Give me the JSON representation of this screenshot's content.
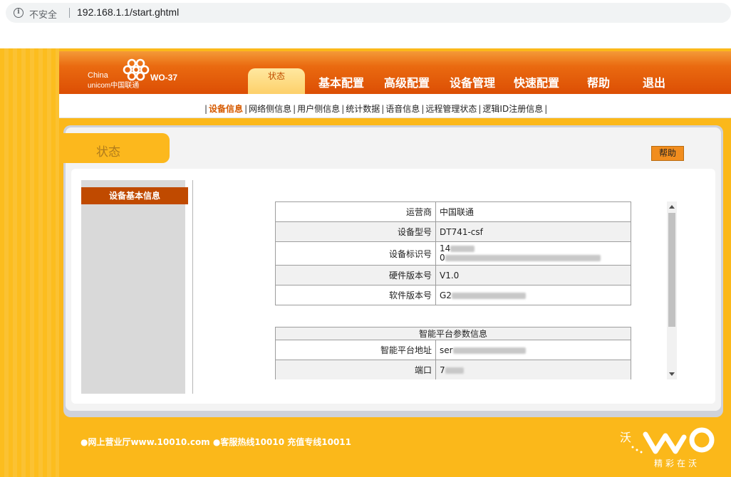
{
  "browser": {
    "security_label": "不安全",
    "url": "192.168.1.1/start.ghtml"
  },
  "header": {
    "logo_text_1": "China",
    "logo_text_2": "unicom中国联通",
    "model": "WO-37"
  },
  "nav": {
    "items": [
      "状态",
      "基本配置",
      "高级配置",
      "设备管理",
      "快速配置",
      "帮助",
      "退出"
    ],
    "active_index": 0
  },
  "subnav": {
    "items": [
      "设备信息",
      "网络侧信息",
      "用户侧信息",
      "统计数据",
      "语音信息",
      "远程管理状态",
      "逻辑ID注册信息"
    ],
    "active_index": 0
  },
  "panel": {
    "title": "状态",
    "help_label": "帮助"
  },
  "leftnav": {
    "items": [
      "设备基本信息"
    ]
  },
  "device_info": [
    {
      "label": "运营商",
      "value": "中国联通"
    },
    {
      "label": "设备型号",
      "value": "DT741-csf"
    },
    {
      "label": "设备标识号",
      "value_1": "14",
      "value_2": "0"
    },
    {
      "label": "硬件版本号",
      "value": "V1.0"
    },
    {
      "label": "软件版本号",
      "value": "G2"
    }
  ],
  "platform": {
    "header": "智能平台参数信息",
    "rows": [
      {
        "label": "智能平台地址",
        "value": "ser"
      },
      {
        "label": "端口",
        "value": "7"
      }
    ]
  },
  "footer": {
    "text": "●网上营业厅www.10010.com ●客服热线10010 充值专线10011",
    "slogan": "精彩在沃"
  },
  "colors": {
    "brand_orange": "#dc4e04",
    "page_yellow": "#fbb81a",
    "active_item": "#c04a00"
  }
}
